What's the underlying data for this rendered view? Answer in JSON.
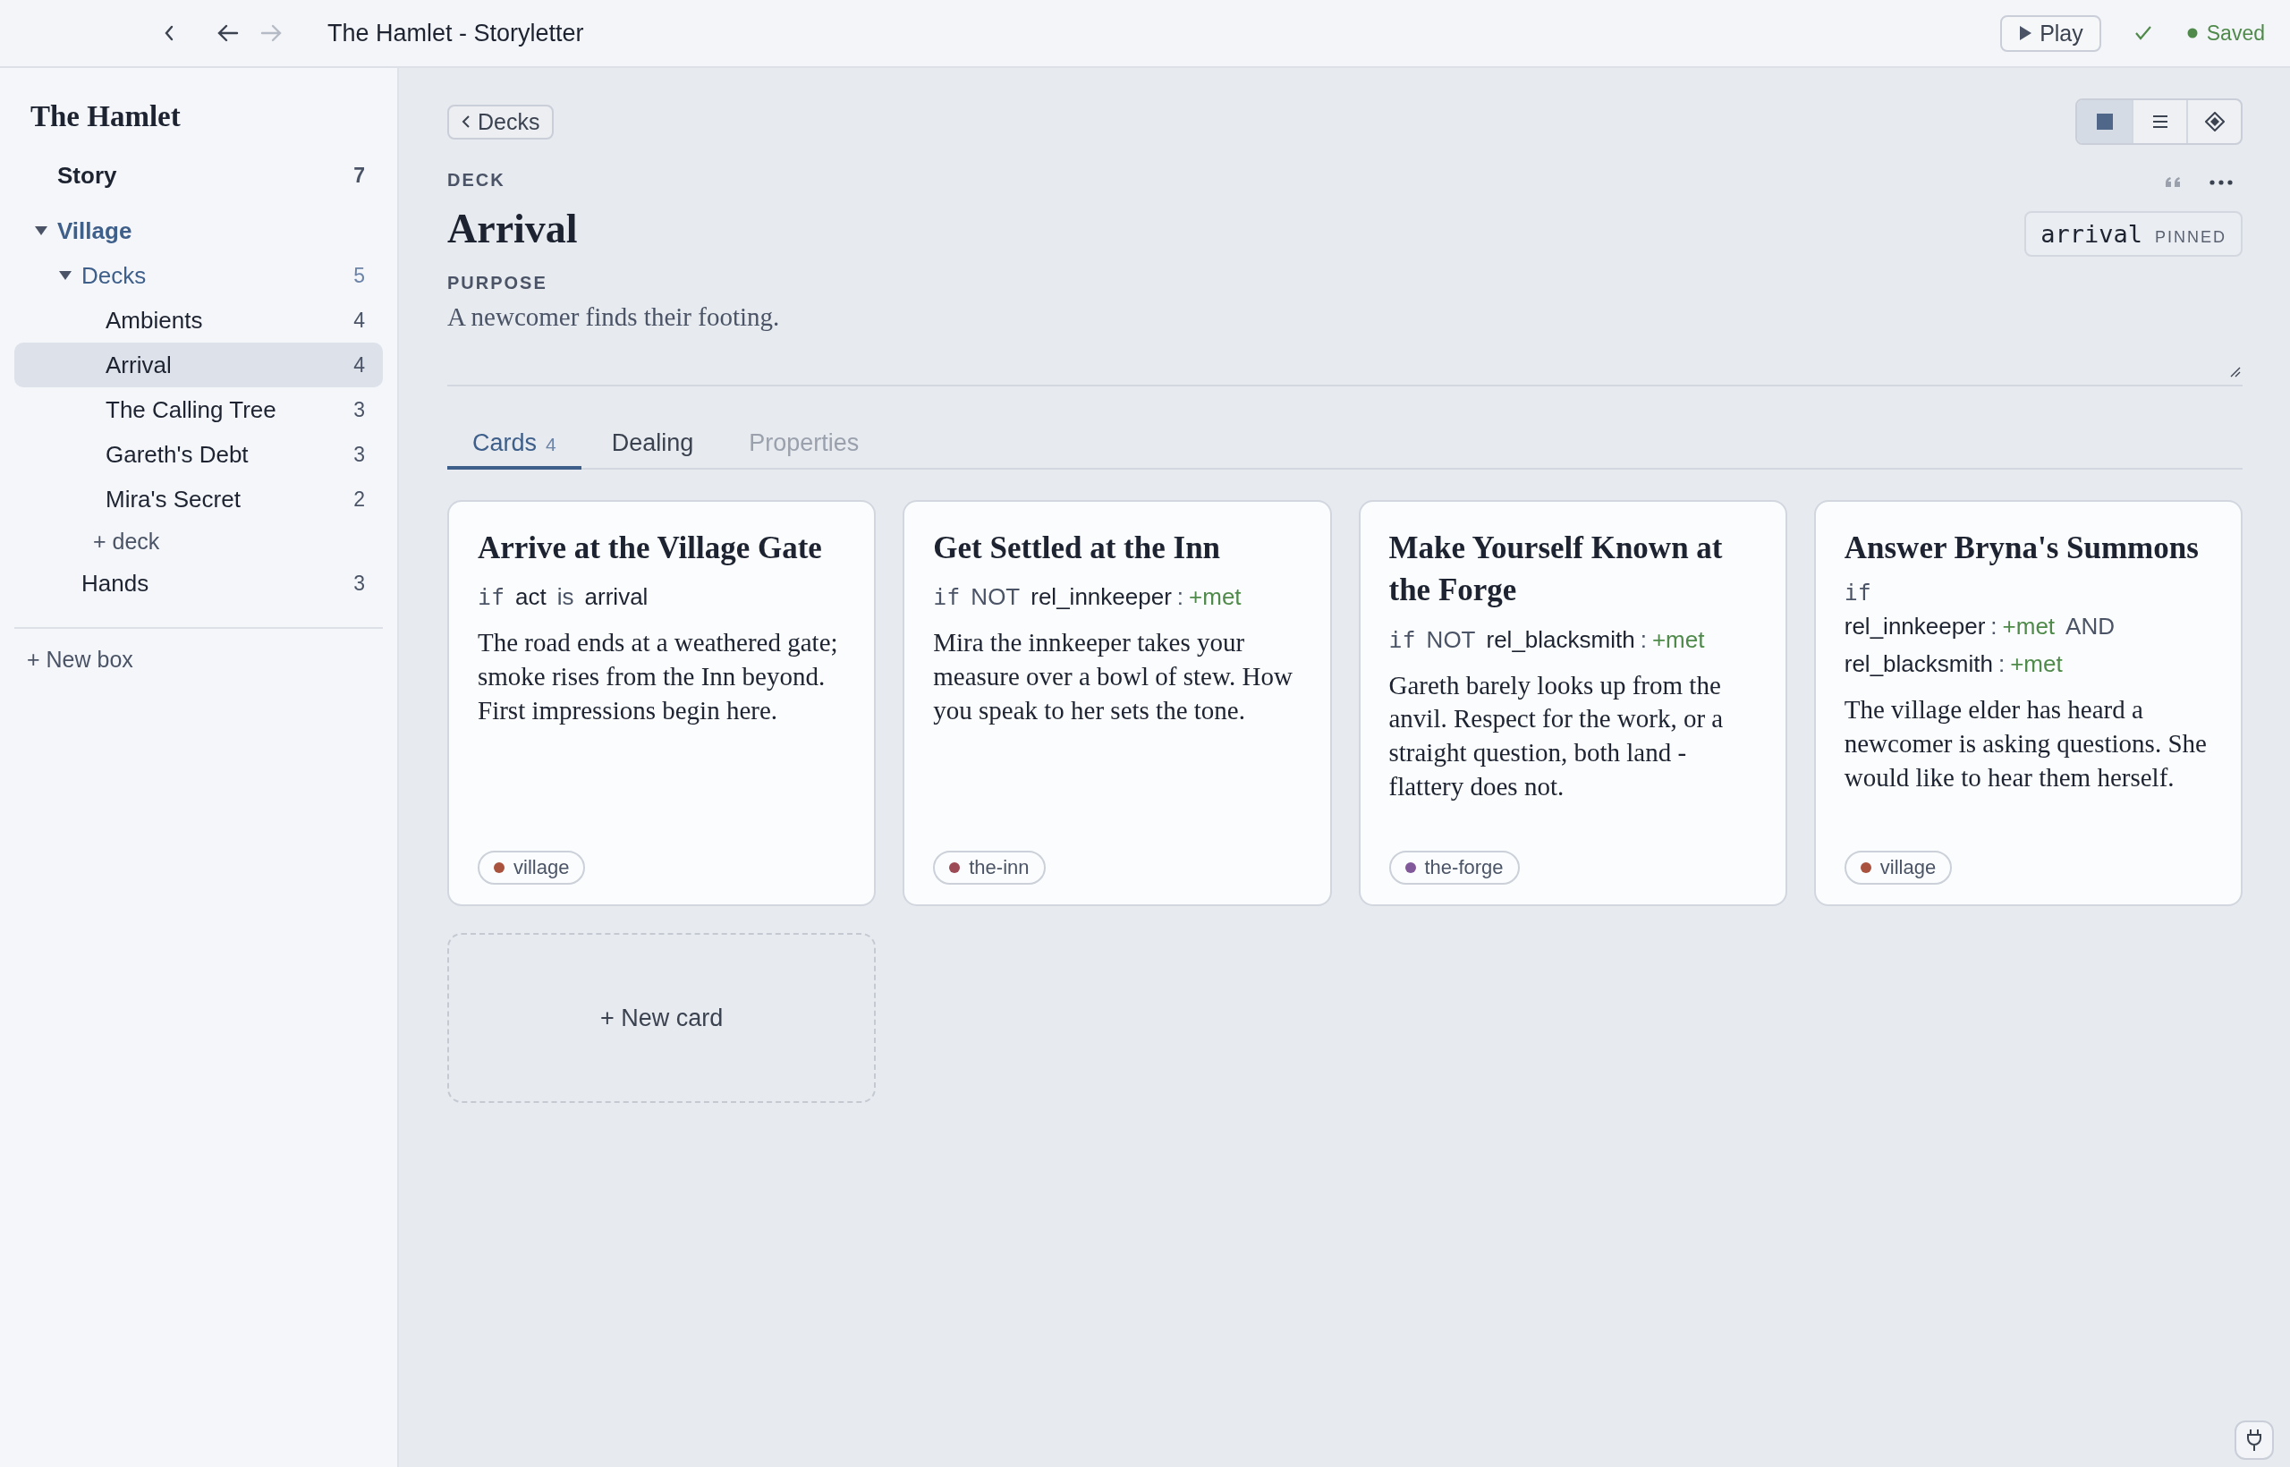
{
  "topbar": {
    "title": "The Hamlet - Storyletter",
    "forward_disabled": true,
    "play_label": "Play",
    "saved_label": "Saved"
  },
  "sidebar": {
    "title": "The Hamlet",
    "items": [
      {
        "label": "Story",
        "count": "7",
        "kind": "section"
      },
      {
        "label": "Village",
        "kind": "group",
        "expanded": true,
        "children": [
          {
            "label": "Decks",
            "count": "5",
            "kind": "folder",
            "expanded": true,
            "add_label": "+ deck",
            "children": [
              {
                "label": "Ambients",
                "count": "4",
                "kind": "item",
                "selected": false
              },
              {
                "label": "Arrival",
                "count": "4",
                "kind": "item",
                "selected": true
              },
              {
                "label": "The Calling Tree",
                "count": "3",
                "kind": "item",
                "selected": false
              },
              {
                "label": "Gareth's Debt",
                "count": "3",
                "kind": "item",
                "selected": false
              },
              {
                "label": "Mira's Secret",
                "count": "2",
                "kind": "item",
                "selected": false
              }
            ]
          },
          {
            "label": "Hands",
            "count": "3",
            "kind": "item"
          }
        ]
      }
    ],
    "new_box_label": "+ New box"
  },
  "back_button": "Decks",
  "view_modes": [
    {
      "kind": "grid",
      "selected": true
    },
    {
      "kind": "list",
      "selected": false
    },
    {
      "kind": "diamond",
      "selected": false
    }
  ],
  "deck": {
    "eyebrow": "DECK",
    "title": "Arrival",
    "key": "arrival",
    "key_status": "PINNED",
    "purpose_label": "PURPOSE",
    "purpose": "A newcomer finds their footing."
  },
  "tabs": [
    {
      "label": "Cards",
      "count": "4",
      "selected": true,
      "disabled": false
    },
    {
      "label": "Dealing",
      "selected": false,
      "disabled": false
    },
    {
      "label": "Properties",
      "selected": false,
      "disabled": true
    }
  ],
  "cards": [
    {
      "title": "Arrive at the Village Gate",
      "condition": [
        [
          {
            "kind": "keyword",
            "text": "if"
          },
          {
            "kind": "var",
            "text": "act"
          },
          {
            "kind": "op",
            "text": "is"
          },
          {
            "kind": "var",
            "text": "arrival"
          }
        ]
      ],
      "body": "The road ends at a weathered gate; smoke rises from the Inn beyond. First impressions begin here.",
      "tag": {
        "label": "village",
        "color": "#a9533f"
      }
    },
    {
      "title": "Get Settled at the Inn",
      "condition": [
        [
          {
            "kind": "keyword",
            "text": "if"
          },
          {
            "kind": "op",
            "text": "NOT"
          },
          {
            "kind": "var",
            "text": "rel_innkeeper"
          },
          {
            "kind": "sep",
            "text": ":"
          },
          {
            "kind": "value",
            "text": "+met"
          }
        ]
      ],
      "body": "Mira the innkeeper takes your measure over a bowl of stew. How you speak to her sets the tone.",
      "tag": {
        "label": "the-inn",
        "color": "#9c4a55"
      }
    },
    {
      "title": "Make Yourself Known at the Forge",
      "condition": [
        [
          {
            "kind": "keyword",
            "text": "if"
          },
          {
            "kind": "op",
            "text": "NOT"
          },
          {
            "kind": "var",
            "text": "rel_blacksmith"
          },
          {
            "kind": "sep",
            "text": ":"
          },
          {
            "kind": "value",
            "text": "+met"
          }
        ]
      ],
      "body": "Gareth barely looks up from the anvil. Respect for the work, or a straight question, both land - flattery does not.",
      "tag": {
        "label": "the-forge",
        "color": "#81589a"
      }
    },
    {
      "title": "Answer Bryna's Summons",
      "condition": [
        [
          {
            "kind": "keyword",
            "text": "if"
          }
        ],
        [
          {
            "kind": "var",
            "text": "rel_innkeeper"
          },
          {
            "kind": "sep",
            "text": ":"
          },
          {
            "kind": "value",
            "text": "+met"
          },
          {
            "kind": "op",
            "text": "AND"
          }
        ],
        [
          {
            "kind": "var",
            "text": "rel_blacksmith"
          },
          {
            "kind": "sep",
            "text": ":"
          },
          {
            "kind": "value",
            "text": "+met"
          }
        ]
      ],
      "body": "The village elder has heard a newcomer is asking questions. She would like to hear them herself.",
      "tag": {
        "label": "village",
        "color": "#a9533f"
      }
    }
  ],
  "new_card_label": "+ New card"
}
